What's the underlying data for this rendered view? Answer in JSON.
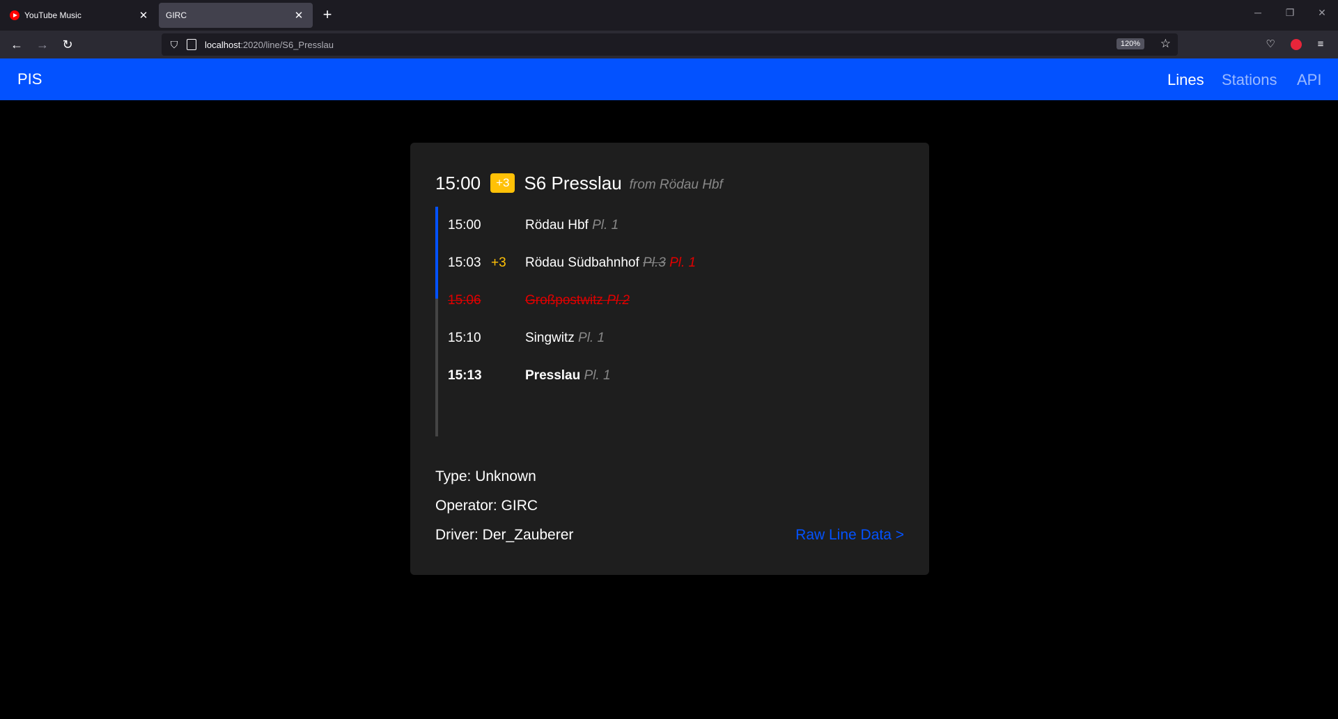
{
  "browser": {
    "tabs": [
      {
        "title": "YouTube Music",
        "active": false
      },
      {
        "title": "GIRC",
        "active": true
      }
    ],
    "url_host": "localhost",
    "url_path": ":2020/line/S6_Presslau",
    "zoom": "120%"
  },
  "app": {
    "brand": "PIS",
    "nav": [
      {
        "label": "Lines",
        "active": true
      },
      {
        "label": "Stations",
        "active": false
      },
      {
        "label": "API",
        "active": false
      }
    ]
  },
  "line": {
    "departure_time": "15:00",
    "delay": "+3",
    "name": "S6 Presslau",
    "origin": "from Rödau Hbf",
    "stops": [
      {
        "time": "15:00",
        "delay": "",
        "name": "Rödau Hbf",
        "platform": "Pl. 1",
        "old_platform": "",
        "cancelled": false,
        "terminus": false
      },
      {
        "time": "15:03",
        "delay": "+3",
        "name": "Rödau Südbahnhof",
        "platform": "Pl. 1",
        "old_platform": "Pl.3",
        "cancelled": false,
        "terminus": false
      },
      {
        "time": "15:06",
        "delay": "",
        "name": "Großpostwitz",
        "platform": "Pl.2",
        "old_platform": "",
        "cancelled": true,
        "terminus": false
      },
      {
        "time": "15:10",
        "delay": "",
        "name": "Singwitz",
        "platform": "Pl. 1",
        "old_platform": "",
        "cancelled": false,
        "terminus": false
      },
      {
        "time": "15:13",
        "delay": "",
        "name": "Presslau",
        "platform": "Pl. 1",
        "old_platform": "",
        "cancelled": false,
        "terminus": true
      }
    ],
    "type": "Type: Unknown",
    "operator": "Operator: GIRC",
    "driver": "Driver: Der_Zauberer",
    "raw_link": "Raw Line Data >"
  },
  "colors": {
    "accent": "#0352ff",
    "delay": "#ffc107",
    "cancelled": "#e00000",
    "card": "#1e1e1e"
  }
}
